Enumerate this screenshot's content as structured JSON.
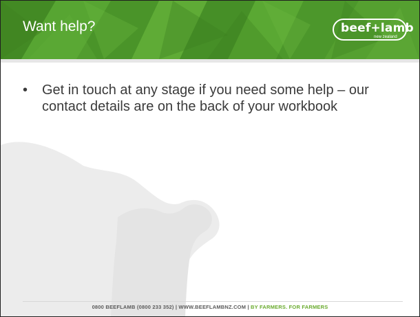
{
  "slide": {
    "title": "Want help?",
    "logo": {
      "main": "beef+lamb",
      "sub": "new zealand"
    },
    "bullets": [
      {
        "marker": "•",
        "text": "Get in touch at any stage if you need some help – our contact details are on the back of your workbook"
      }
    ],
    "footer": {
      "contact": "0800 BEEFLAMB (0800 233 352) | WWW.BEEFLAMBNZ.COM | ",
      "tagline": "BY FARMERS. FOR FARMERS"
    }
  },
  "colors": {
    "header_green": "#4e9a2c",
    "accent_green": "#6aab2e",
    "body_text": "#3a3a3a",
    "silhouette_gray": "#ececec"
  },
  "icons": {
    "background": "animal-silhouette-icon"
  }
}
